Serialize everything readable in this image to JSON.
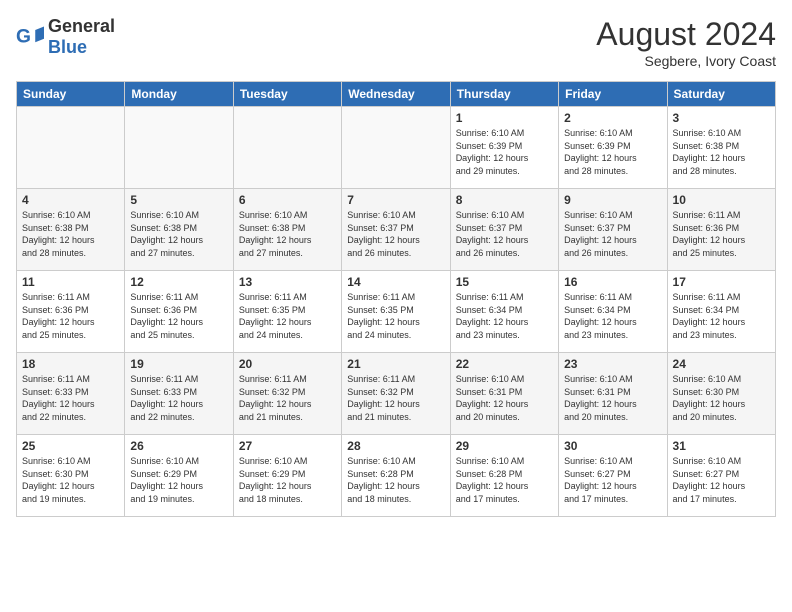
{
  "header": {
    "logo_general": "General",
    "logo_blue": "Blue",
    "title": "August 2024",
    "location": "Segbere, Ivory Coast"
  },
  "weekdays": [
    "Sunday",
    "Monday",
    "Tuesday",
    "Wednesday",
    "Thursday",
    "Friday",
    "Saturday"
  ],
  "weeks": [
    [
      {
        "day": "",
        "info": ""
      },
      {
        "day": "",
        "info": ""
      },
      {
        "day": "",
        "info": ""
      },
      {
        "day": "",
        "info": ""
      },
      {
        "day": "1",
        "info": "Sunrise: 6:10 AM\nSunset: 6:39 PM\nDaylight: 12 hours\nand 29 minutes."
      },
      {
        "day": "2",
        "info": "Sunrise: 6:10 AM\nSunset: 6:39 PM\nDaylight: 12 hours\nand 28 minutes."
      },
      {
        "day": "3",
        "info": "Sunrise: 6:10 AM\nSunset: 6:38 PM\nDaylight: 12 hours\nand 28 minutes."
      }
    ],
    [
      {
        "day": "4",
        "info": "Sunrise: 6:10 AM\nSunset: 6:38 PM\nDaylight: 12 hours\nand 28 minutes."
      },
      {
        "day": "5",
        "info": "Sunrise: 6:10 AM\nSunset: 6:38 PM\nDaylight: 12 hours\nand 27 minutes."
      },
      {
        "day": "6",
        "info": "Sunrise: 6:10 AM\nSunset: 6:38 PM\nDaylight: 12 hours\nand 27 minutes."
      },
      {
        "day": "7",
        "info": "Sunrise: 6:10 AM\nSunset: 6:37 PM\nDaylight: 12 hours\nand 26 minutes."
      },
      {
        "day": "8",
        "info": "Sunrise: 6:10 AM\nSunset: 6:37 PM\nDaylight: 12 hours\nand 26 minutes."
      },
      {
        "day": "9",
        "info": "Sunrise: 6:10 AM\nSunset: 6:37 PM\nDaylight: 12 hours\nand 26 minutes."
      },
      {
        "day": "10",
        "info": "Sunrise: 6:11 AM\nSunset: 6:36 PM\nDaylight: 12 hours\nand 25 minutes."
      }
    ],
    [
      {
        "day": "11",
        "info": "Sunrise: 6:11 AM\nSunset: 6:36 PM\nDaylight: 12 hours\nand 25 minutes."
      },
      {
        "day": "12",
        "info": "Sunrise: 6:11 AM\nSunset: 6:36 PM\nDaylight: 12 hours\nand 25 minutes."
      },
      {
        "day": "13",
        "info": "Sunrise: 6:11 AM\nSunset: 6:35 PM\nDaylight: 12 hours\nand 24 minutes."
      },
      {
        "day": "14",
        "info": "Sunrise: 6:11 AM\nSunset: 6:35 PM\nDaylight: 12 hours\nand 24 minutes."
      },
      {
        "day": "15",
        "info": "Sunrise: 6:11 AM\nSunset: 6:34 PM\nDaylight: 12 hours\nand 23 minutes."
      },
      {
        "day": "16",
        "info": "Sunrise: 6:11 AM\nSunset: 6:34 PM\nDaylight: 12 hours\nand 23 minutes."
      },
      {
        "day": "17",
        "info": "Sunrise: 6:11 AM\nSunset: 6:34 PM\nDaylight: 12 hours\nand 23 minutes."
      }
    ],
    [
      {
        "day": "18",
        "info": "Sunrise: 6:11 AM\nSunset: 6:33 PM\nDaylight: 12 hours\nand 22 minutes."
      },
      {
        "day": "19",
        "info": "Sunrise: 6:11 AM\nSunset: 6:33 PM\nDaylight: 12 hours\nand 22 minutes."
      },
      {
        "day": "20",
        "info": "Sunrise: 6:11 AM\nSunset: 6:32 PM\nDaylight: 12 hours\nand 21 minutes."
      },
      {
        "day": "21",
        "info": "Sunrise: 6:11 AM\nSunset: 6:32 PM\nDaylight: 12 hours\nand 21 minutes."
      },
      {
        "day": "22",
        "info": "Sunrise: 6:10 AM\nSunset: 6:31 PM\nDaylight: 12 hours\nand 20 minutes."
      },
      {
        "day": "23",
        "info": "Sunrise: 6:10 AM\nSunset: 6:31 PM\nDaylight: 12 hours\nand 20 minutes."
      },
      {
        "day": "24",
        "info": "Sunrise: 6:10 AM\nSunset: 6:30 PM\nDaylight: 12 hours\nand 20 minutes."
      }
    ],
    [
      {
        "day": "25",
        "info": "Sunrise: 6:10 AM\nSunset: 6:30 PM\nDaylight: 12 hours\nand 19 minutes."
      },
      {
        "day": "26",
        "info": "Sunrise: 6:10 AM\nSunset: 6:29 PM\nDaylight: 12 hours\nand 19 minutes."
      },
      {
        "day": "27",
        "info": "Sunrise: 6:10 AM\nSunset: 6:29 PM\nDaylight: 12 hours\nand 18 minutes."
      },
      {
        "day": "28",
        "info": "Sunrise: 6:10 AM\nSunset: 6:28 PM\nDaylight: 12 hours\nand 18 minutes."
      },
      {
        "day": "29",
        "info": "Sunrise: 6:10 AM\nSunset: 6:28 PM\nDaylight: 12 hours\nand 17 minutes."
      },
      {
        "day": "30",
        "info": "Sunrise: 6:10 AM\nSunset: 6:27 PM\nDaylight: 12 hours\nand 17 minutes."
      },
      {
        "day": "31",
        "info": "Sunrise: 6:10 AM\nSunset: 6:27 PM\nDaylight: 12 hours\nand 17 minutes."
      }
    ]
  ]
}
